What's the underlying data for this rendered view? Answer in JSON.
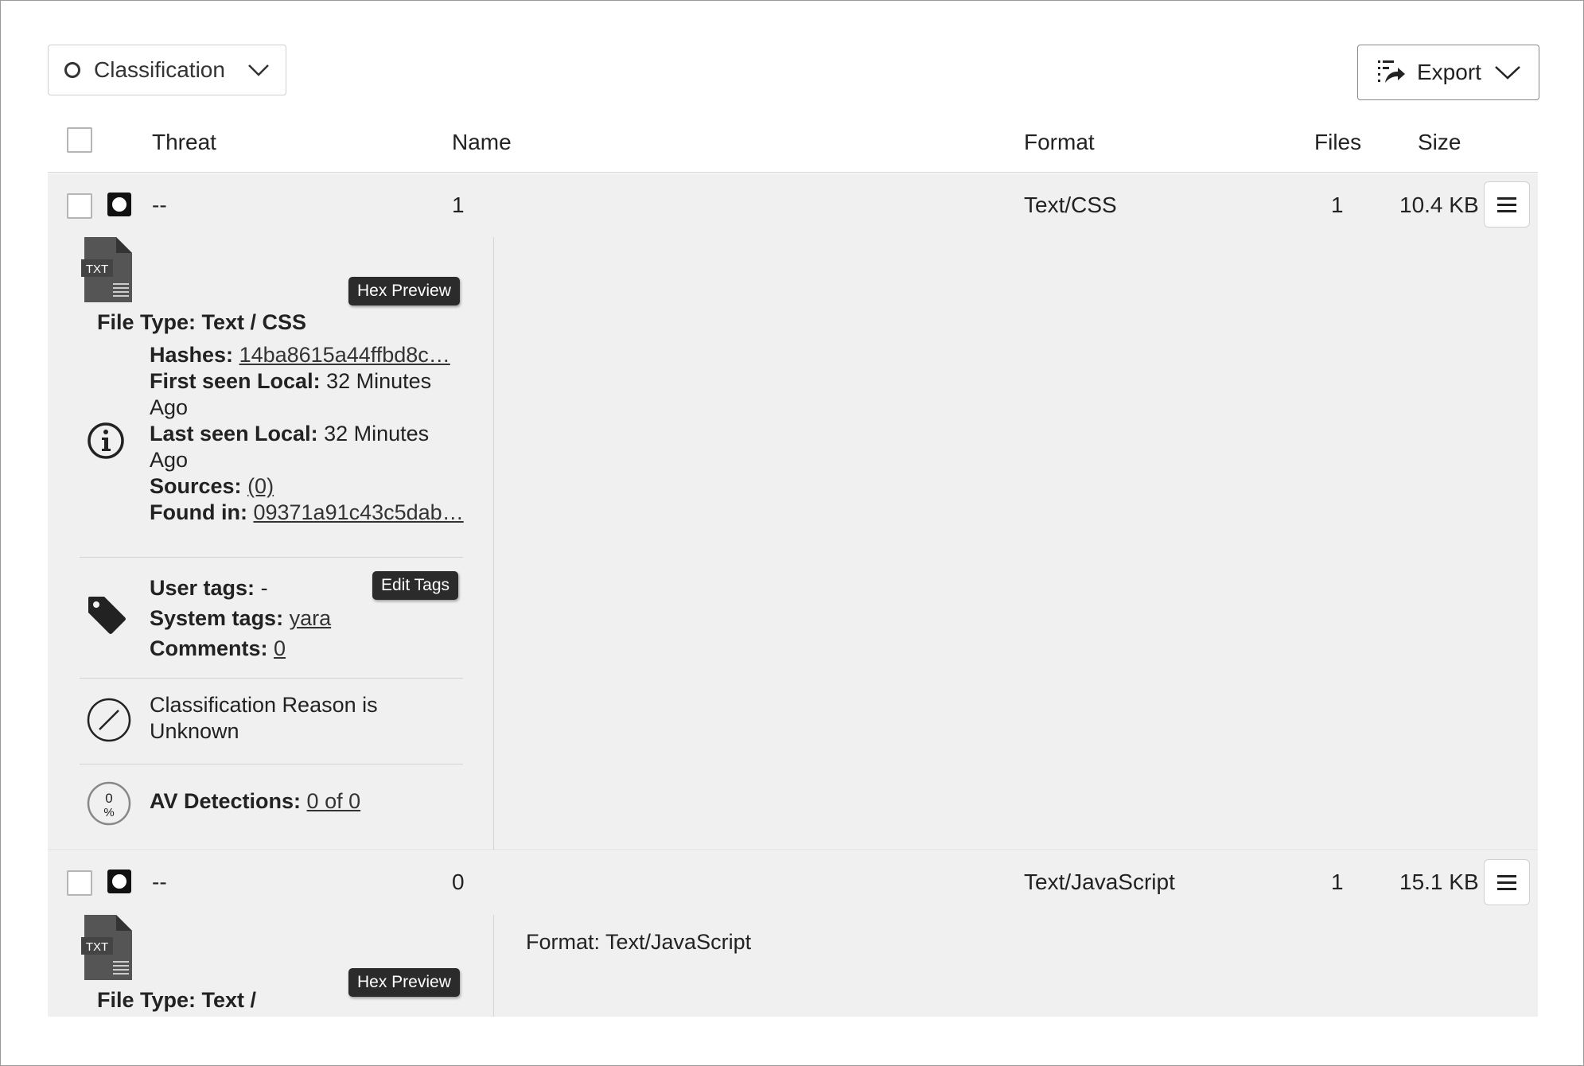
{
  "toolbar": {
    "classification_label": "Classification",
    "export_label": "Export"
  },
  "table": {
    "headers": {
      "threat": "Threat",
      "name": "Name",
      "format": "Format",
      "files": "Files",
      "size": "Size"
    },
    "rows": [
      {
        "threat": "--",
        "name": "1",
        "format": "Text/CSS",
        "files": "1",
        "size": "10.4 KB",
        "icon_label": "TXT",
        "hex_preview_label": "Hex Preview",
        "file_type": "File Type: Text / CSS",
        "details": {
          "hashes_label": "Hashes:",
          "hashes_value": "14ba8615a44ffbd8c…",
          "first_seen_label": "First seen Local:",
          "first_seen_value": "32 Minutes Ago",
          "last_seen_label": "Last seen Local:",
          "last_seen_value": "32 Minutes Ago",
          "sources_label": "Sources:",
          "sources_value": "(0)",
          "found_in_label": "Found in:",
          "found_in_value": "09371a91c43c5dab…"
        },
        "tags": {
          "edit_tags_label": "Edit Tags",
          "user_tags_label": "User tags:",
          "user_tags_value": "-",
          "system_tags_label": "System tags:",
          "system_tags_value": "yara",
          "comments_label": "Comments:",
          "comments_value": "0"
        },
        "classification_reason": "Classification Reason is Unknown",
        "av": {
          "label": "AV Detections:",
          "value": "0 of 0",
          "icon_top": "0",
          "icon_bottom": "%"
        }
      },
      {
        "threat": "--",
        "name": "0",
        "format": "Text/JavaScript",
        "files": "1",
        "size": "15.1 KB",
        "icon_label": "TXT",
        "hex_preview_label": "Hex Preview",
        "file_type": "File Type: Text /",
        "format_detail": "Format: Text/JavaScript"
      }
    ]
  }
}
